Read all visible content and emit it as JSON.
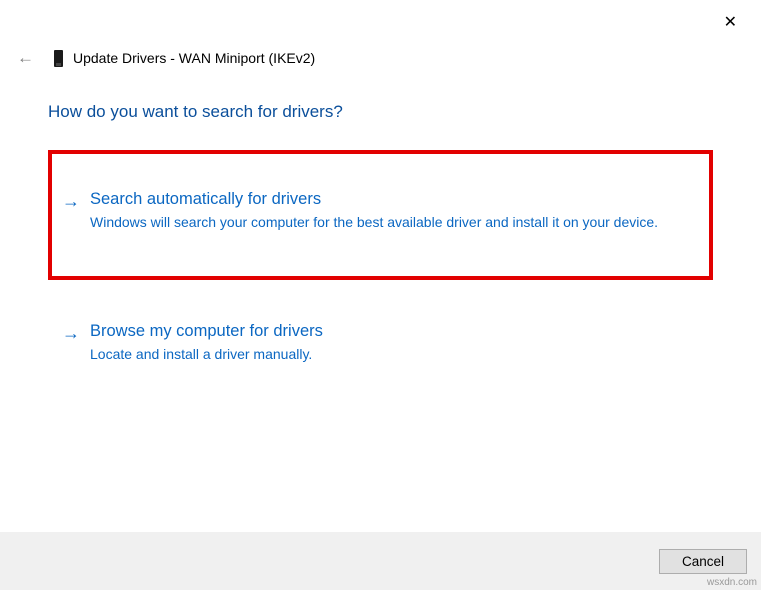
{
  "close_icon": "✕",
  "back_icon": "←",
  "window_title": "Update Drivers - WAN Miniport (IKEv2)",
  "main_heading": "How do you want to search for drivers?",
  "options": [
    {
      "arrow": "→",
      "title": "Search automatically for drivers",
      "desc": "Windows will search your computer for the best available driver and install it on your device."
    },
    {
      "arrow": "→",
      "title": "Browse my computer for drivers",
      "desc": "Locate and install a driver manually."
    }
  ],
  "footer": {
    "cancel_label": "Cancel"
  },
  "watermark": "wsxdn.com"
}
